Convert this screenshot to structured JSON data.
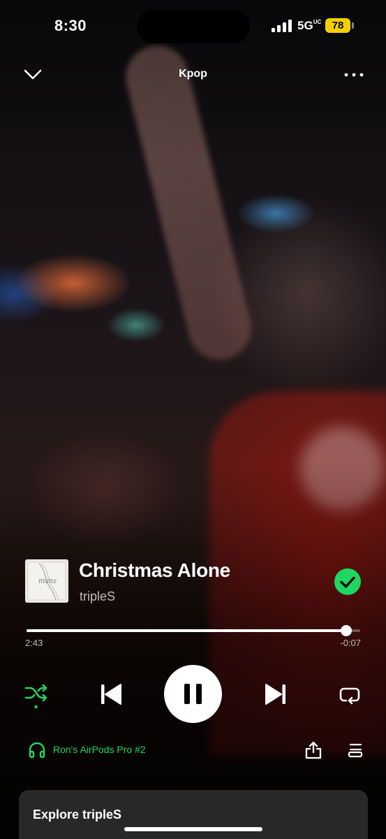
{
  "status_bar": {
    "time": "8:30",
    "network": "5G",
    "network_suffix": "UC",
    "battery": "78"
  },
  "header": {
    "title": "Kpop"
  },
  "track": {
    "album_art_text": "msnz",
    "title": "Christmas Alone",
    "artist": "tripleS",
    "liked": true
  },
  "playback": {
    "elapsed": "2:43",
    "remaining": "-0:07",
    "progress_fraction": 0.959,
    "state": "playing",
    "shuffle_on": true,
    "repeat": "off"
  },
  "device": {
    "label": "Ron's AirPods Pro #2"
  },
  "explore": {
    "title": "Explore tripleS"
  },
  "colors": {
    "accent": "#1ed760",
    "battery": "#f5d000"
  },
  "icons": {
    "collapse": "chevron-down-icon",
    "more": "more-icon",
    "liked": "check-circle-icon",
    "shuffle": "shuffle-icon",
    "previous": "skip-previous-icon",
    "pause": "pause-icon",
    "next": "skip-next-icon",
    "repeat": "repeat-icon",
    "device": "headphones-icon",
    "share": "share-icon",
    "queue": "queue-icon"
  }
}
